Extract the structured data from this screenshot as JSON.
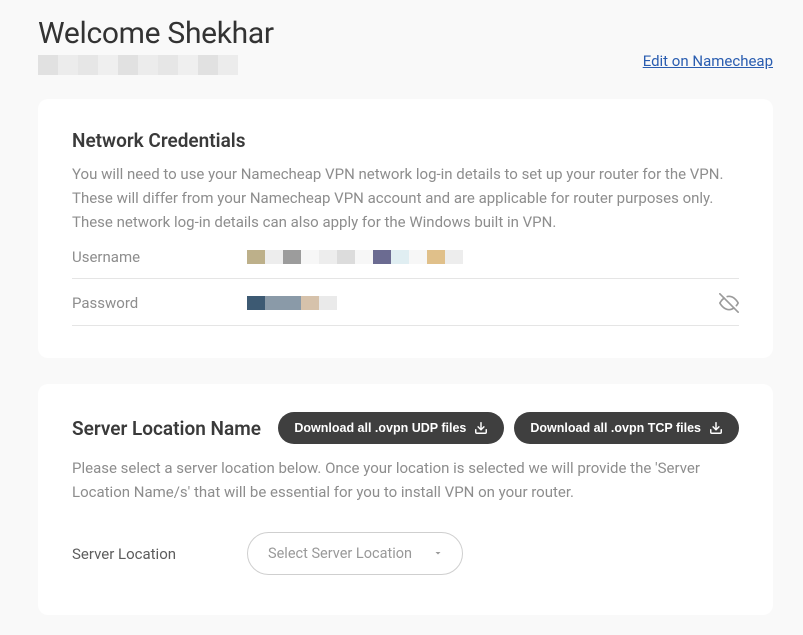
{
  "header": {
    "welcome": "Welcome Shekhar",
    "edit_link": "Edit on Namecheap"
  },
  "network_credentials": {
    "title": "Network Credentials",
    "description": "You will need to use your Namecheap VPN network log-in details to set up your router for the VPN. These will differ from your Namecheap VPN account and are applicable for router purposes only. These network log-in details can also apply for the Windows built in VPN.",
    "username_label": "Username",
    "password_label": "Password"
  },
  "server_location": {
    "title": "Server Location Name",
    "download_udp": "Download all .ovpn UDP files",
    "download_tcp": "Download all .ovpn TCP files",
    "description": "Please select a server location below. Once your location is selected we will provide the 'Server Location Name/s' that will be essential for you to install VPN on your router.",
    "select_label": "Server Location",
    "select_placeholder": "Select Server Location"
  }
}
